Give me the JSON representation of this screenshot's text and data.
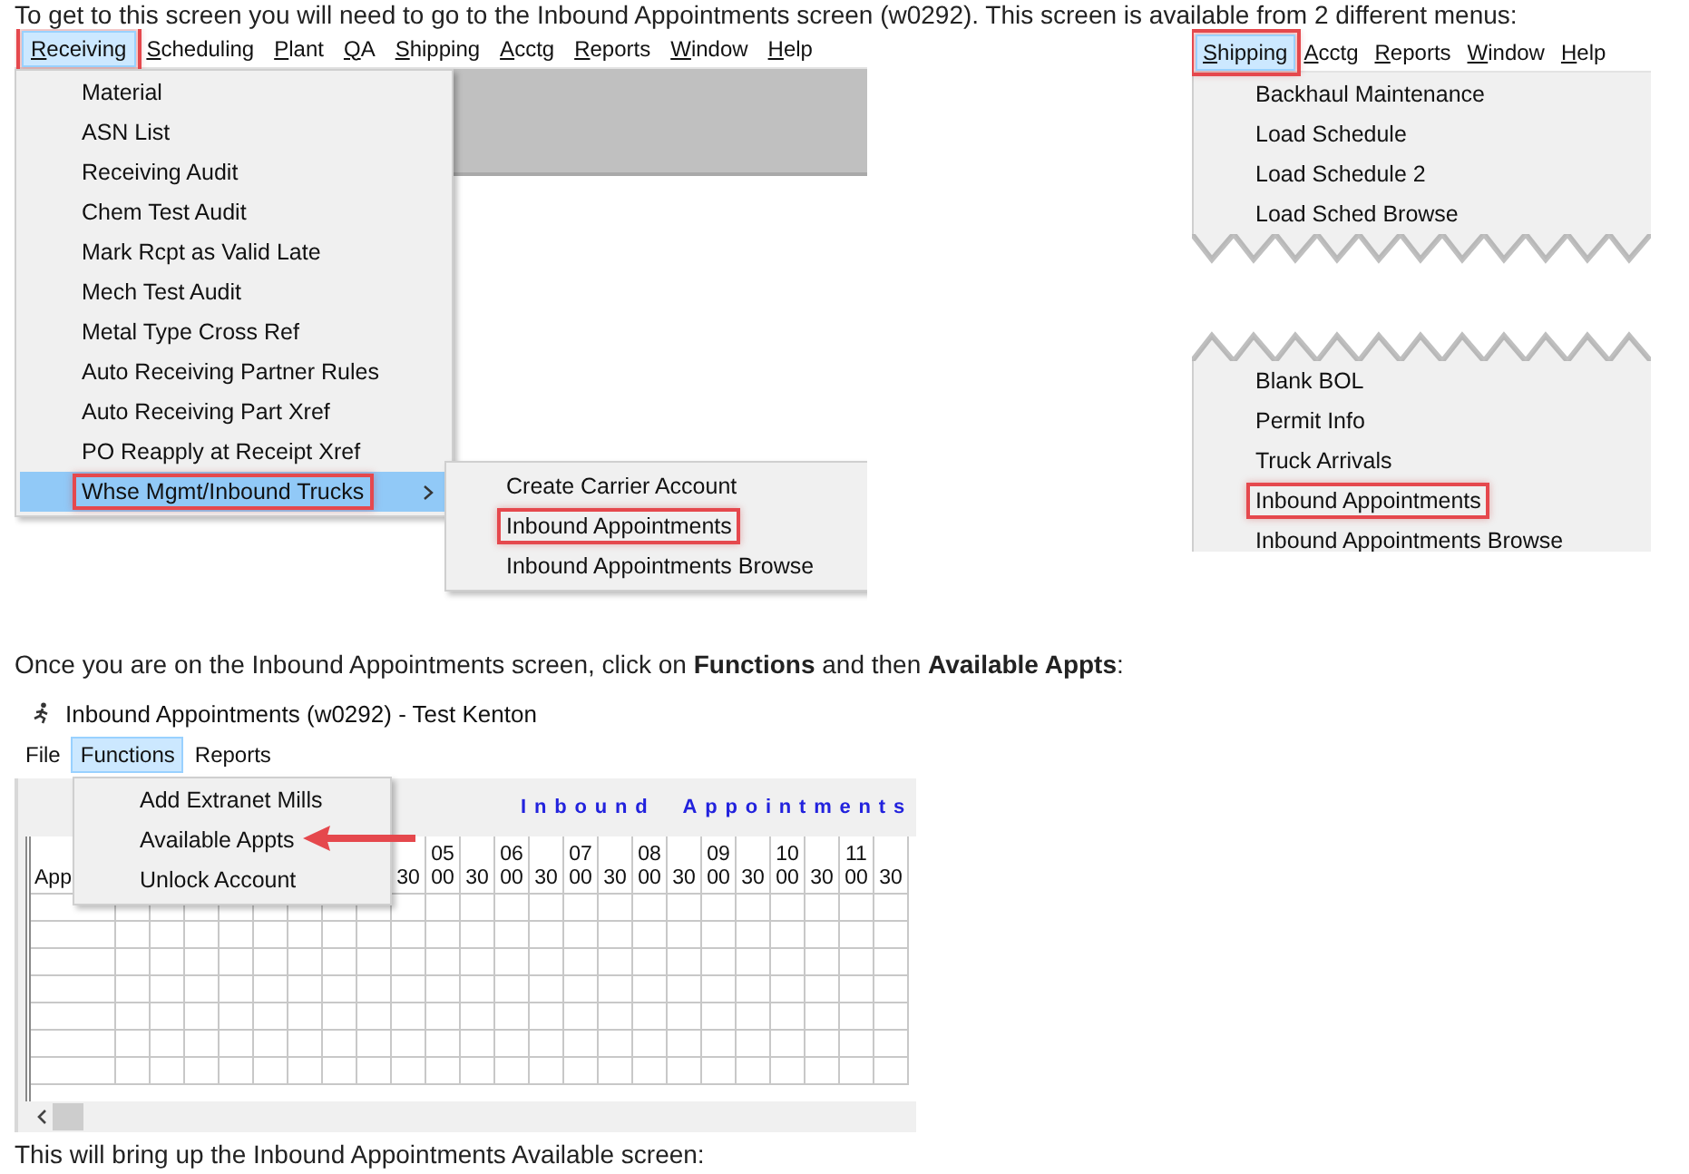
{
  "intro": "To get to this screen you will need to go to the Inbound Appointments screen (w0292). This screen is available from 2 different menus:",
  "receiving_shot": {
    "menubar": [
      {
        "label": "Receiving",
        "selected": true,
        "outlined": true
      },
      {
        "label": "Scheduling",
        "selected": false,
        "outlined": false
      },
      {
        "label": "Plant",
        "selected": false,
        "outlined": false
      },
      {
        "label": "QA",
        "selected": false,
        "outlined": false
      },
      {
        "label": "Shipping",
        "selected": false,
        "outlined": false
      },
      {
        "label": "Acctg",
        "selected": false,
        "outlined": false
      },
      {
        "label": "Reports",
        "selected": false,
        "outlined": false
      },
      {
        "label": "Window",
        "selected": false,
        "outlined": false
      },
      {
        "label": "Help",
        "selected": false,
        "outlined": false
      }
    ],
    "menu": [
      {
        "label": "Material",
        "selected": false,
        "outlined": false,
        "submenu": false
      },
      {
        "label": "ASN List",
        "selected": false,
        "outlined": false,
        "submenu": false
      },
      {
        "label": "Receiving Audit",
        "selected": false,
        "outlined": false,
        "submenu": false
      },
      {
        "label": "Chem Test Audit",
        "selected": false,
        "outlined": false,
        "submenu": false
      },
      {
        "label": "Mark Rcpt as Valid Late",
        "selected": false,
        "outlined": false,
        "submenu": false
      },
      {
        "label": "Mech Test Audit",
        "selected": false,
        "outlined": false,
        "submenu": false
      },
      {
        "label": "Metal Type Cross Ref",
        "selected": false,
        "outlined": false,
        "submenu": false
      },
      {
        "label": "Auto Receiving Partner Rules",
        "selected": false,
        "outlined": false,
        "submenu": false
      },
      {
        "label": "Auto Receiving Part Xref",
        "selected": false,
        "outlined": false,
        "submenu": false
      },
      {
        "label": "PO Reapply at Receipt Xref",
        "selected": false,
        "outlined": false,
        "submenu": false
      },
      {
        "label": "Whse Mgmt/Inbound Trucks",
        "selected": true,
        "outlined": true,
        "submenu": true
      }
    ],
    "submenu": [
      {
        "label": "Create Carrier Account",
        "outlined": false
      },
      {
        "label": "Inbound Appointments",
        "outlined": true
      },
      {
        "label": "Inbound Appointments Browse",
        "outlined": false
      }
    ]
  },
  "shipping_shot": {
    "menubar": [
      {
        "label": "Shipping",
        "selected": true,
        "outlined": true
      },
      {
        "label": "Acctg",
        "selected": false,
        "outlined": false
      },
      {
        "label": "Reports",
        "selected": false,
        "outlined": false
      },
      {
        "label": "Window",
        "selected": false,
        "outlined": false
      },
      {
        "label": "Help",
        "selected": false,
        "outlined": false
      }
    ],
    "menu_top": [
      {
        "label": "Backhaul Maintenance",
        "outlined": false
      },
      {
        "label": "Load Schedule",
        "outlined": false
      },
      {
        "label": "Load Schedule 2",
        "outlined": false
      },
      {
        "label": "Load Sched Browse",
        "outlined": false
      }
    ],
    "menu_bottom": [
      {
        "label": "Blank BOL",
        "outlined": false
      },
      {
        "label": "Permit Info",
        "outlined": false
      },
      {
        "label": "Truck Arrivals",
        "outlined": false
      },
      {
        "label": "Inbound Appointments",
        "outlined": true
      },
      {
        "label": "Inbound Appointments Browse",
        "outlined": false
      }
    ]
  },
  "instruction": "Once you are on the Inbound Appointments screen, click on **Functions** and then **Available Appts**:",
  "appointments_shot": {
    "window_title": "Inbound Appointments (w0292) - Test Kenton",
    "menubar": [
      {
        "label": "File",
        "selected": false
      },
      {
        "label": "Functions",
        "selected": true
      },
      {
        "label": "Reports",
        "selected": false
      }
    ],
    "heading": "Inbound Appointments",
    "grid": {
      "first_column": "App",
      "columns": [
        {
          "minute": "30"
        },
        {
          "hour": "05",
          "minute": "00"
        },
        {
          "minute": "30"
        },
        {
          "hour": "06",
          "minute": "00"
        },
        {
          "minute": "30"
        },
        {
          "hour": "07",
          "minute": "00"
        },
        {
          "minute": "30"
        },
        {
          "hour": "08",
          "minute": "00"
        },
        {
          "minute": "30"
        },
        {
          "hour": "09",
          "minute": "00"
        },
        {
          "minute": "30"
        },
        {
          "hour": "10",
          "minute": "00"
        },
        {
          "minute": "30"
        },
        {
          "hour": "11",
          "minute": "00"
        },
        {
          "minute": "30"
        }
      ]
    },
    "menu": [
      {
        "label": "Add Extranet Mills",
        "pointed": false
      },
      {
        "label": "Available Appts",
        "pointed": true
      },
      {
        "label": "Unlock Account",
        "pointed": false
      }
    ]
  },
  "outro": "This will bring up the Inbound Appointments Available screen:"
}
